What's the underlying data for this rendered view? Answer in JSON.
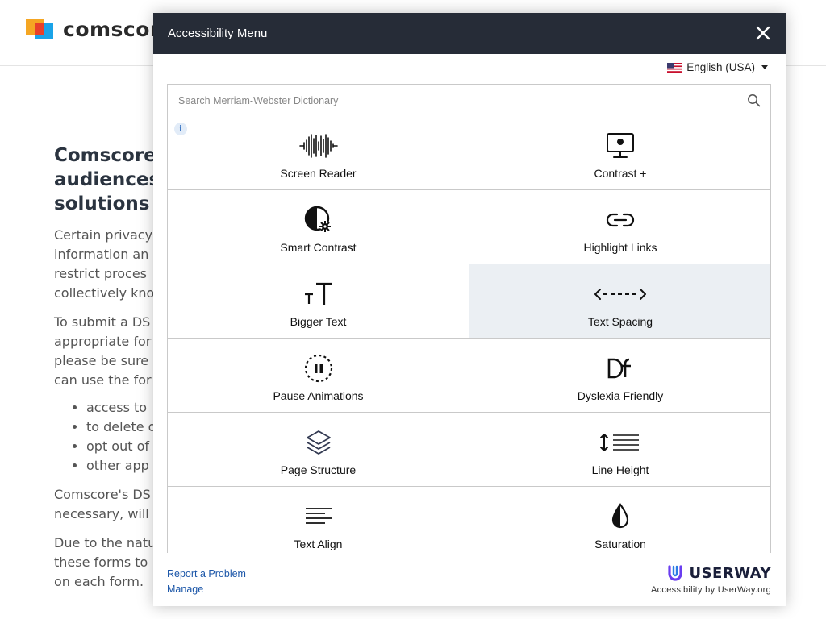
{
  "background_page": {
    "logo_text": "comscore",
    "heading_lines": [
      "Comscore",
      "audiences",
      "solutions t"
    ],
    "paragraph1_lines": [
      "Certain privacy",
      "information an",
      "restrict proces",
      "collectively kno"
    ],
    "paragraph2_lines": [
      "To submit a DS",
      "appropriate for",
      "please be sure",
      "can use the for"
    ],
    "list_items": [
      "access to",
      "to delete o",
      "opt out of",
      "other app"
    ],
    "paragraph3_lines": [
      "Comscore's DS",
      "necessary, will"
    ],
    "paragraph4_lines": [
      "Due to the natu",
      "these forms to",
      "on each form."
    ]
  },
  "modal": {
    "title": "Accessibility Menu",
    "close_icon": "close-icon",
    "language": "English (USA)",
    "search_placeholder": "Search Merriam-Webster Dictionary",
    "info_badge": "i",
    "tiles": [
      {
        "label": "Screen Reader",
        "icon": "sound-wave-icon"
      },
      {
        "label": "Contrast +",
        "icon": "monitor-icon"
      },
      {
        "label": "Smart Contrast",
        "icon": "smart-contrast-icon"
      },
      {
        "label": "Highlight Links",
        "icon": "link-icon"
      },
      {
        "label": "Bigger Text",
        "icon": "bigger-text-icon"
      },
      {
        "label": "Text Spacing",
        "icon": "text-spacing-icon"
      },
      {
        "label": "Pause Animations",
        "icon": "pause-icon"
      },
      {
        "label": "Dyslexia Friendly",
        "icon": "dyslexia-icon"
      },
      {
        "label": "Page Structure",
        "icon": "layers-icon"
      },
      {
        "label": "Line Height",
        "icon": "line-height-icon"
      },
      {
        "label": "Text Align",
        "icon": "text-align-icon"
      },
      {
        "label": "Saturation",
        "icon": "droplet-icon"
      }
    ],
    "footer": {
      "report_link": "Report a Problem",
      "manage_link": "Manage",
      "brand_name": "USERWAY",
      "brand_sub": "Accessibility by UserWay.org"
    }
  },
  "colors": {
    "header_bg": "#262c37",
    "active_tile_bg": "#ebeff3",
    "link": "#1b56a8",
    "brand_purple": "#6a3df0"
  }
}
